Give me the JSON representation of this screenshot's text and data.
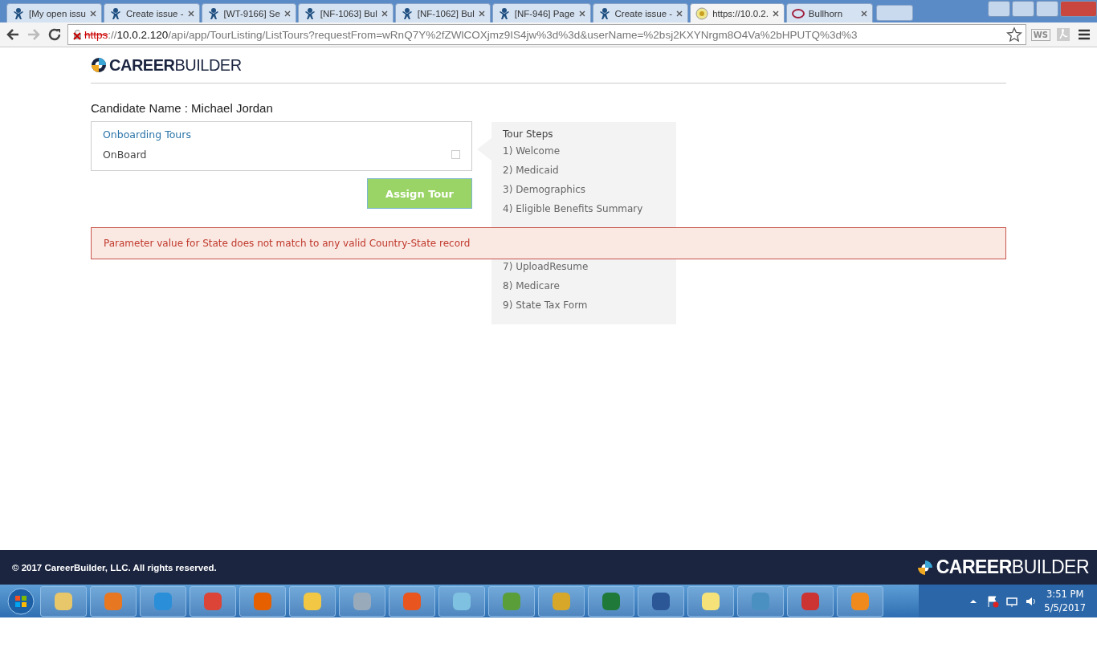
{
  "browser": {
    "tabs": [
      {
        "title": "[My open issu",
        "kind": "jira",
        "selected": false
      },
      {
        "title": "Create issue -",
        "kind": "jira",
        "selected": false
      },
      {
        "title": "[WT-9166] Se",
        "kind": "jira",
        "selected": false
      },
      {
        "title": "[NF-1063] Bul",
        "kind": "jira",
        "selected": false
      },
      {
        "title": "[NF-1062] Bul",
        "kind": "jira",
        "selected": false
      },
      {
        "title": "[NF-946] Page",
        "kind": "jira",
        "selected": false
      },
      {
        "title": "Create issue -",
        "kind": "jira",
        "selected": false
      },
      {
        "title": "https://10.0.2.",
        "kind": "site",
        "selected": true
      },
      {
        "title": "Bullhorn",
        "kind": "ring",
        "selected": false
      }
    ],
    "url_scheme": "https",
    "url_separator": "://",
    "url_host": "10.0.2.120",
    "url_path": "/api/app/TourListing/ListTours?requestFrom=wRnQ7Y%2fZWlCOXjmz9IS4jw%3d%3d&userName=%2bsj2KXYNrgm8O4Va%2bHPUTQ%3d%3",
    "extension": "WS"
  },
  "header": {
    "logo": "**CAREER**BUILDER"
  },
  "candidate": "Candidate Name : Michael Jordan",
  "tours": {
    "title": "Onboarding Tours",
    "items": [
      {
        "name": "OnBoard",
        "checked": false
      }
    ]
  },
  "assign_button": "Assign Tour",
  "tour_steps": {
    "title": "Tour Steps",
    "before": [
      "1) Welcome",
      "2) Medicaid",
      "3) Demographics",
      "4) Eligible Benefits Summary"
    ],
    "after": [
      "7) UploadResume",
      "8) Medicare",
      "9) State Tax Form"
    ]
  },
  "alert": "Parameter value for State does not match to any valid Country-State record",
  "footer": {
    "copyright": "© 2017 CareerBuilder, LLC. All rights reserved.",
    "logo": "**CAREER**BUILDER"
  },
  "taskbar": {
    "apps": [
      {
        "kind": "folder"
      },
      {
        "kind": "media"
      },
      {
        "kind": "ie"
      },
      {
        "kind": "chrome"
      },
      {
        "kind": "firefox"
      },
      {
        "kind": "outlook"
      },
      {
        "kind": "paint"
      },
      {
        "kind": "app"
      },
      {
        "kind": "notepad"
      },
      {
        "kind": "table"
      },
      {
        "kind": "tools"
      },
      {
        "kind": "excel"
      },
      {
        "kind": "word"
      },
      {
        "kind": "notes"
      },
      {
        "kind": "photo"
      },
      {
        "kind": "snip"
      },
      {
        "kind": "flame"
      }
    ],
    "time": "3:51 PM",
    "date": "5/5/2017"
  }
}
